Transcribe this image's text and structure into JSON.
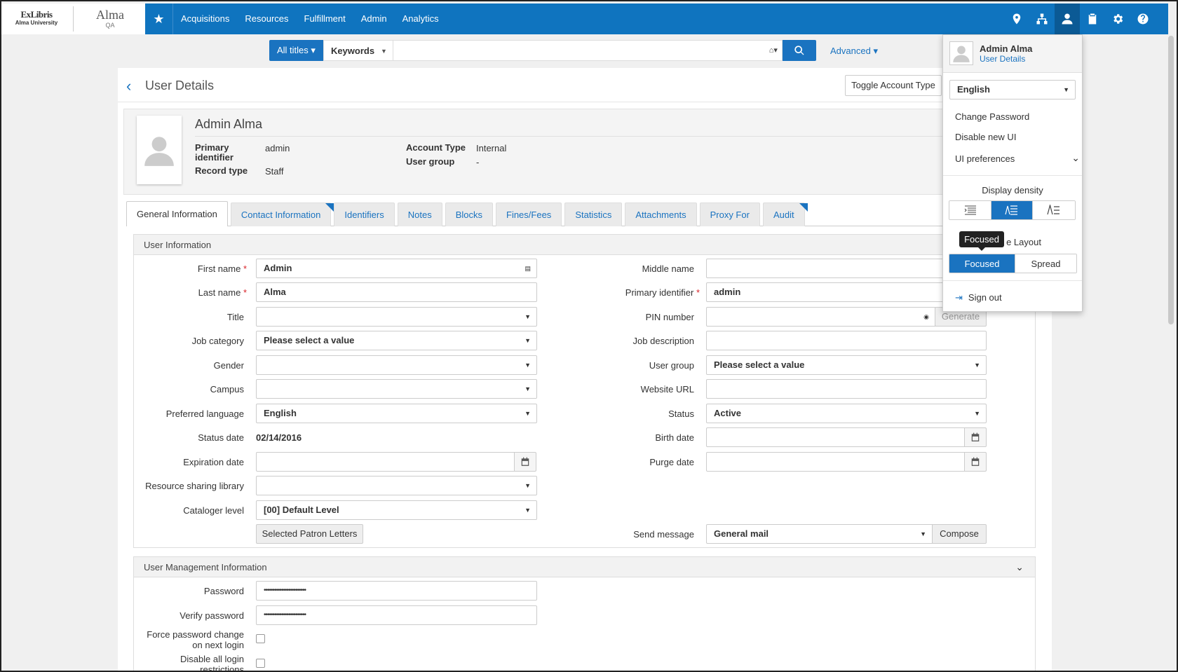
{
  "logos": {
    "exlibris_a": "ExLibris",
    "exlibris_b": "Alma University",
    "alma_a": "Alma",
    "alma_b": "QA"
  },
  "topnav": [
    "Acquisitions",
    "Resources",
    "Fulfillment",
    "Admin",
    "Analytics"
  ],
  "top_icons": [
    "location-pin-icon",
    "sitemap-icon",
    "user-icon",
    "clipboard-icon",
    "gear-icon",
    "help-icon"
  ],
  "search": {
    "scope": "All titles",
    "field": "Keywords",
    "advanced": "Advanced"
  },
  "page": {
    "title": "User Details",
    "toggle_account": "Toggle Account Type"
  },
  "user_header": {
    "name": "Admin Alma",
    "primary_id_label": "Primary identifier",
    "primary_id_value": "admin",
    "record_type_label": "Record type",
    "record_type_value": "Staff",
    "account_type_label": "Account Type",
    "account_type_value": "Internal",
    "user_group_label": "User group",
    "user_group_value": "-"
  },
  "tabs": [
    "General Information",
    "Contact Information",
    "Identifiers",
    "Notes",
    "Blocks",
    "Fines/Fees",
    "Statistics",
    "Attachments",
    "Proxy For",
    "Audit"
  ],
  "user_info": {
    "section_title": "User Information",
    "first_name_label": "First name",
    "first_name_value": "Admin",
    "last_name_label": "Last name",
    "last_name_value": "Alma",
    "title_label": "Title",
    "job_category_label": "Job category",
    "job_category_value": "Please select a value",
    "gender_label": "Gender",
    "campus_label": "Campus",
    "pref_lang_label": "Preferred language",
    "pref_lang_value": "English",
    "status_date_label": "Status date",
    "status_date_value": "02/14/2016",
    "expiration_label": "Expiration date",
    "rs_library_label": "Resource sharing library",
    "cataloger_label": "Cataloger level",
    "cataloger_value": "[00] Default Level",
    "patron_letters_btn": "Selected Patron Letters",
    "middle_name_label": "Middle name",
    "primary_identifier_label": "Primary identifier",
    "primary_identifier_value": "admin",
    "pin_label": "PIN number",
    "generate_btn": "Generate",
    "job_desc_label": "Job description",
    "user_group_label": "User group",
    "user_group_value": "Please select a value",
    "website_label": "Website URL",
    "status_label": "Status",
    "status_value": "Active",
    "birth_label": "Birth date",
    "purge_label": "Purge date",
    "send_msg_label": "Send message",
    "send_msg_value": "General mail",
    "compose_btn": "Compose"
  },
  "user_mgmt": {
    "section_title": "User Management Information",
    "password_label": "Password",
    "password_value": "••••••••••••••••••••••••",
    "verify_label": "Verify password",
    "verify_value": "••••••••••••••••••••••••",
    "force_change_label": "Force password change on next login",
    "disable_login_label": "Disable all login restrictions"
  },
  "user_menu": {
    "name": "Admin Alma",
    "details_link": "User Details",
    "language": "English",
    "change_password": "Change Password",
    "disable_new_ui": "Disable new UI",
    "ui_preferences": "UI preferences",
    "display_density": "Display density",
    "layout_label": "e Layout",
    "layout_focused": "Focused",
    "layout_spread": "Spread",
    "tooltip": "Focused",
    "sign_out": "Sign out"
  }
}
